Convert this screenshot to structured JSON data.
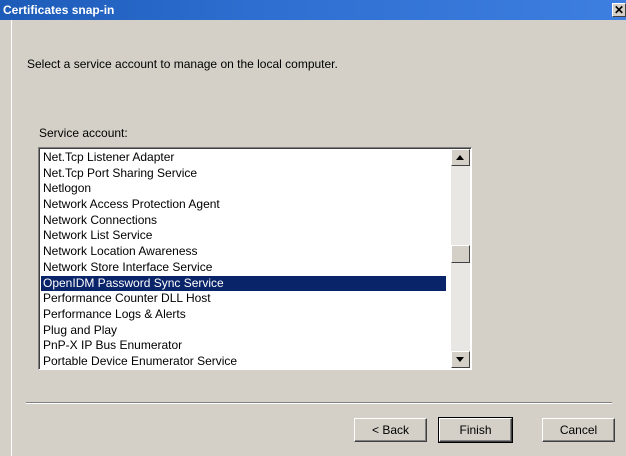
{
  "window": {
    "title": "Certificates snap-in",
    "close_glyph": "✕"
  },
  "main": {
    "prompt": "Select a service account to manage on the local computer.",
    "service_label": "Service account:",
    "services": [
      "Net.Tcp Listener Adapter",
      "Net.Tcp Port Sharing Service",
      "Netlogon",
      "Network Access Protection Agent",
      "Network Connections",
      "Network List Service",
      "Network Location Awareness",
      "Network Store Interface Service",
      "OpenIDM Password Sync Service",
      "Performance Counter DLL Host",
      "Performance Logs & Alerts",
      "Plug and Play",
      "PnP-X IP Bus Enumerator",
      "Portable Device Enumerator Service"
    ],
    "selected_index": 8
  },
  "buttons": {
    "back": "< Back",
    "finish": "Finish",
    "cancel": "Cancel"
  },
  "colors": {
    "title_bar": "#1d5bb8",
    "dialog_face": "#d4d0c8",
    "selection": "#0a246a"
  }
}
